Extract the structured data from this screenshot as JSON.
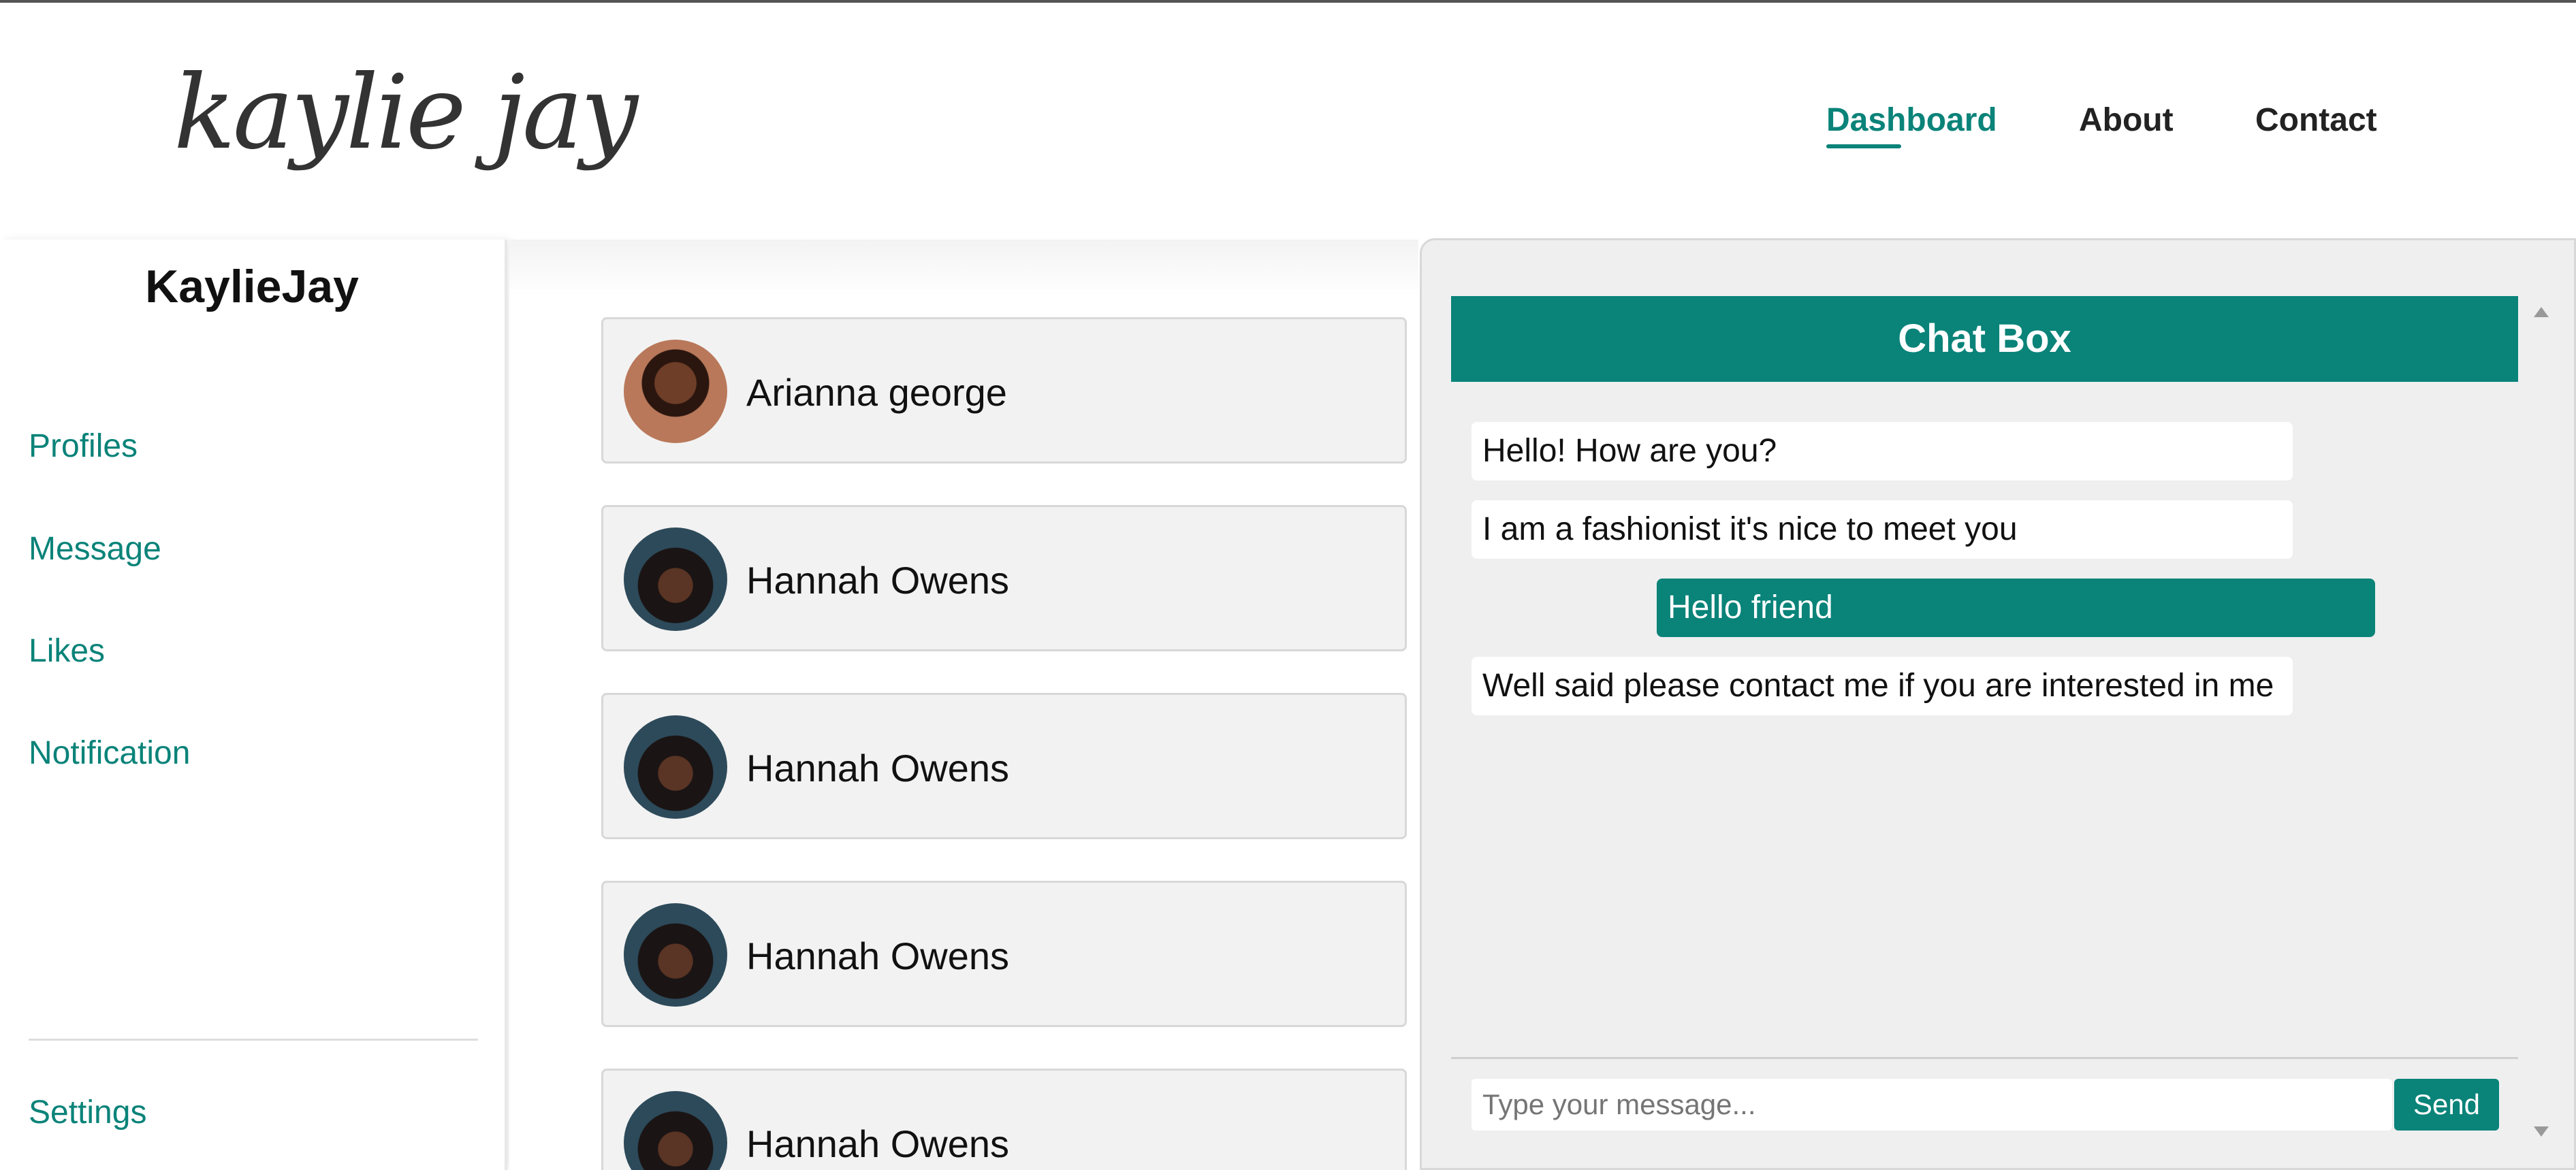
{
  "header": {
    "logo_text": "kaylie jay",
    "nav": {
      "dashboard": "Dashboard",
      "about": "About",
      "contact": "Contact"
    }
  },
  "sidebar": {
    "title": "KaylieJay",
    "items": [
      "Profiles",
      "Message",
      "Likes",
      "Notification"
    ],
    "settings": "Settings"
  },
  "profiles": [
    {
      "name": "Arianna george",
      "avatar": "woman-portrait-avatar"
    },
    {
      "name": "Hannah Owens",
      "avatar": "woman-portrait-avatar"
    },
    {
      "name": "Hannah Owens",
      "avatar": "woman-portrait-avatar"
    },
    {
      "name": "Hannah Owens",
      "avatar": "woman-portrait-avatar"
    },
    {
      "name": "Hannah Owens",
      "avatar": "woman-portrait-avatar"
    }
  ],
  "chat": {
    "title": "Chat Box",
    "messages": [
      {
        "text": "Hello! How are you?",
        "direction": "incoming"
      },
      {
        "text": "I am a fashionist it's nice to meet you",
        "direction": "incoming"
      },
      {
        "text": "Hello friend",
        "direction": "outgoing"
      },
      {
        "text": "Well said please contact me if you are interested in me",
        "direction": "incoming"
      }
    ],
    "input_placeholder": "Type your message...",
    "send_label": "Send"
  },
  "colors": {
    "accent": "#0a8379",
    "panel_bg": "#efefef",
    "card_bg": "#f2f2f2"
  }
}
